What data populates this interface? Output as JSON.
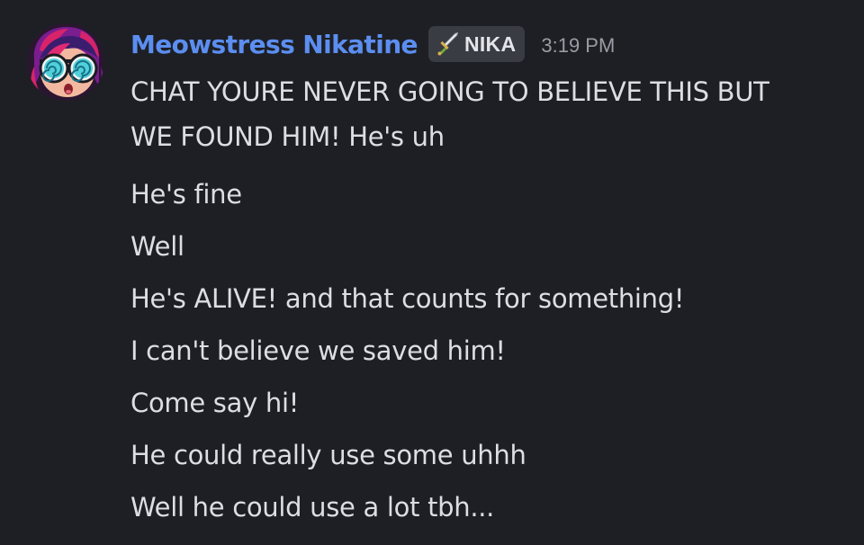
{
  "message": {
    "author": {
      "display_name": "Meowstress Nikatine",
      "name_color": "#5b8ef0",
      "avatar_icon": "avatar-cartoon-cat-girl-icon"
    },
    "tag": {
      "icon": "sword-icon",
      "label": "NIKA"
    },
    "timestamp": "3:19 PM",
    "lines": [
      "CHAT YOURE NEVER GOING TO BELIEVE THIS BUT WE FOUND HIM! He's uh",
      "He's fine",
      "Well",
      "He's ALIVE! and that counts for something!",
      "I can't believe we saved him!",
      "Come say hi!",
      "He could really use some uhhh",
      "Well he could use a lot tbh..."
    ]
  },
  "colors": {
    "background": "#1e1f24",
    "text": "#dcdee3",
    "timestamp": "#9a9ca5",
    "tag_background": "#3a3c43"
  }
}
